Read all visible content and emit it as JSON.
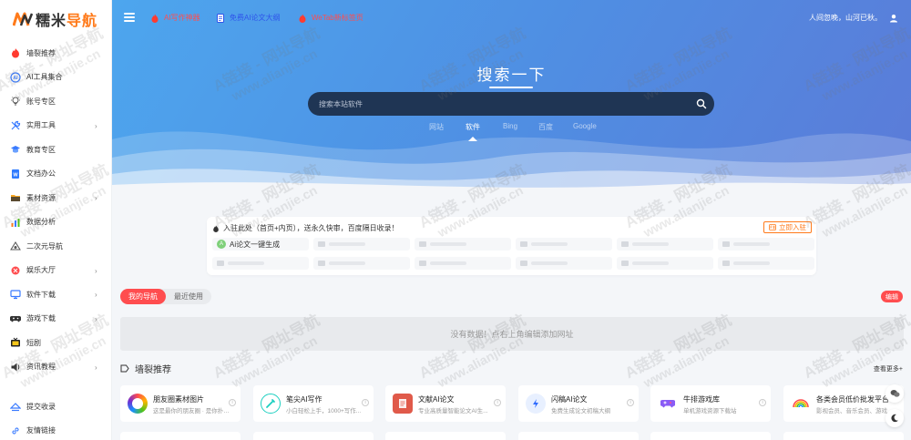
{
  "logo": {
    "part1": "糯米",
    "part2": "导航"
  },
  "sidebar": {
    "items": [
      {
        "label": "墙裂推荐",
        "icon": "hot-icon",
        "chevron": false
      },
      {
        "label": "AI工具集合",
        "icon": "ai-icon",
        "chevron": false
      },
      {
        "label": "账号专区",
        "icon": "bulb-icon",
        "chevron": false
      },
      {
        "label": "实用工具",
        "icon": "tools-icon",
        "chevron": true
      },
      {
        "label": "教育专区",
        "icon": "graduation-icon",
        "chevron": false
      },
      {
        "label": "文档办公",
        "icon": "document-icon",
        "chevron": false
      },
      {
        "label": "素材资源",
        "icon": "folder-icon",
        "chevron": true
      },
      {
        "label": "数据分析",
        "icon": "chart-icon",
        "chevron": false
      },
      {
        "label": "二次元导航",
        "icon": "anime-icon",
        "chevron": false
      },
      {
        "label": "娱乐大厅",
        "icon": "entertainment-icon",
        "chevron": true
      },
      {
        "label": "软件下载",
        "icon": "monitor-icon",
        "chevron": true
      },
      {
        "label": "游戏下载",
        "icon": "gamepad-icon",
        "chevron": true
      },
      {
        "label": "短剧",
        "icon": "tv-icon",
        "chevron": false
      },
      {
        "label": "资讯教程",
        "icon": "speaker-icon",
        "chevron": true
      }
    ],
    "bottom": [
      {
        "label": "提交收录",
        "icon": "submit-icon"
      },
      {
        "label": "友情链接",
        "icon": "link-icon"
      }
    ]
  },
  "topbar": {
    "links": [
      {
        "label": "AI写作神器",
        "color": "#ff4d4f"
      },
      {
        "label": "免费AI论文大纲",
        "color": "#2f54eb"
      },
      {
        "label": "WeTab新标签页",
        "color": "#ff4d4f"
      }
    ],
    "greeting": "人间忽晚，山河已秋。"
  },
  "hero": {
    "title": "搜索一下",
    "search_placeholder": "搜索本站软件",
    "engines": [
      "网站",
      "软件",
      "Bing",
      "百度",
      "Google"
    ],
    "active_engine": "软件"
  },
  "notice": {
    "text": "入驻此处（首页+内页），送永久快审，百度隔日收录！",
    "button": "立即入驻",
    "first_slot": {
      "avatar": "A",
      "label": "Ai论文一键生成"
    }
  },
  "tabs": {
    "items": [
      "我的导航",
      "最近使用"
    ],
    "active": "我的导航",
    "edit": "编辑"
  },
  "empty_text": "没有数据！点右上角编辑添加网址",
  "section": {
    "title": "墙裂推荐",
    "more": "查看更多+",
    "cards": [
      {
        "title": "朋友圈素材图片",
        "desc": "这是最你的朋友圈 · 是你扑朔...",
        "icon_color": "#fff",
        "icon": "ring-icon"
      },
      {
        "title": "笔尖AI写作",
        "desc": "小白轻松上手，1000+写作...",
        "icon_color": "#fff",
        "icon": "pen-icon"
      },
      {
        "title": "文献AI论文",
        "desc": "专业高质量智能论文AI生...",
        "icon_color": "#e05a4a",
        "icon": "paper-icon"
      },
      {
        "title": "闪稿AI论文",
        "desc": "免费生成论文初稿大纲",
        "icon_color": "#fff",
        "icon": "flash-icon"
      },
      {
        "title": "牛排游戏库",
        "desc": "单机游戏资源下载站",
        "icon_color": "#fff",
        "icon": "game-icon"
      },
      {
        "title": "各类会员低价批发平台",
        "desc": "影视会员、音乐会员、游戏...",
        "icon_color": "#fff",
        "icon": "rainbow-icon"
      }
    ]
  },
  "watermark": {
    "line1": "A链接 - 网址导航",
    "line2": "www.alianjie.cn"
  }
}
